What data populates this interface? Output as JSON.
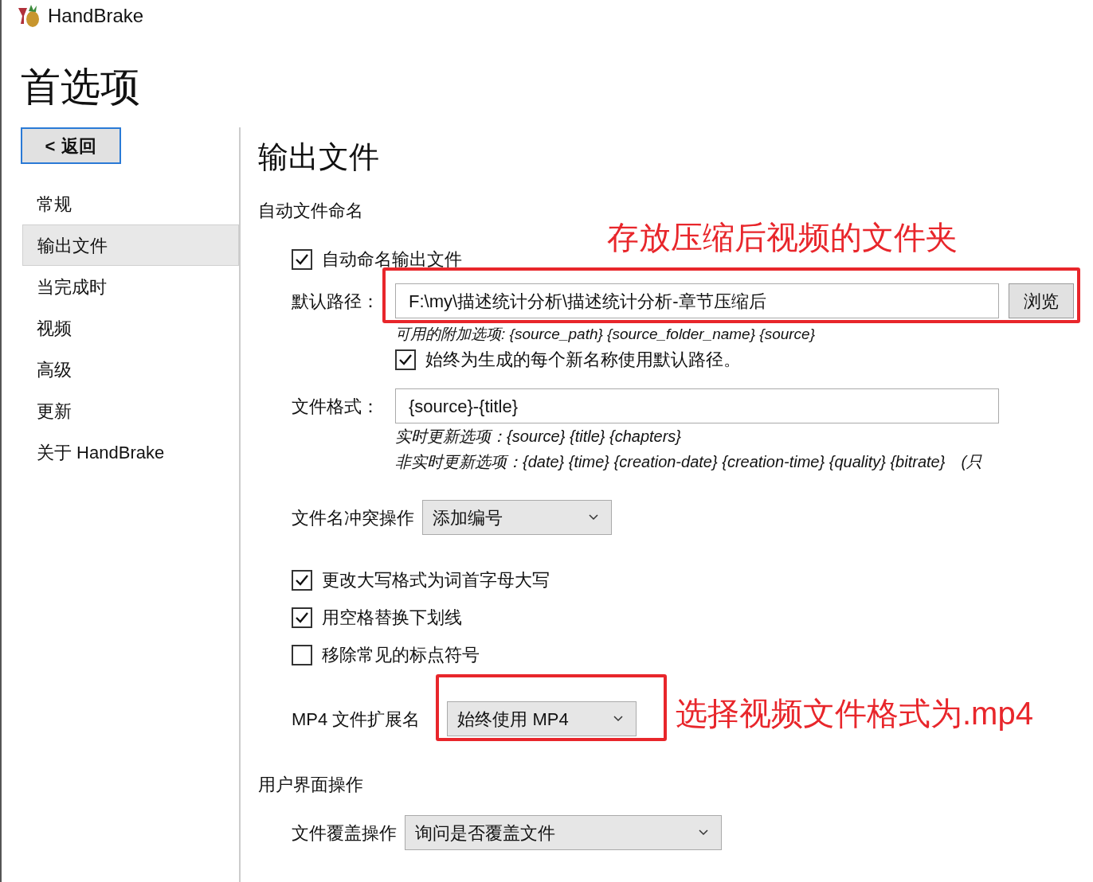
{
  "window": {
    "title": "HandBrake"
  },
  "page_title": "首选项",
  "back_button": {
    "arrow": "<",
    "label": "返回"
  },
  "sidebar": {
    "items": [
      {
        "label": "常规",
        "selected": false
      },
      {
        "label": "输出文件",
        "selected": true
      },
      {
        "label": "当完成时",
        "selected": false
      },
      {
        "label": "视频",
        "selected": false
      },
      {
        "label": "高级",
        "selected": false
      },
      {
        "label": "更新",
        "selected": false
      },
      {
        "label": "关于 HandBrake",
        "selected": false
      }
    ]
  },
  "content": {
    "heading": "输出文件",
    "auto_naming": {
      "title": "自动文件命名",
      "auto_name_checkbox": {
        "label": "自动命名输出文件",
        "checked": true
      },
      "default_path": {
        "label": "默认路径：",
        "value": "F:\\my\\描述统计分析\\描述统计分析-章节压缩后",
        "browse": "浏览"
      },
      "path_hint": "可用的附加选项: {source_path} {source_folder_name} {source}",
      "always_default_checkbox": {
        "label": "始终为生成的每个新名称使用默认路径。",
        "checked": true
      },
      "file_format": {
        "label": "文件格式：",
        "value": "{source}-{title}"
      },
      "format_hints": [
        "实时更新选项：{source} {title} {chapters}",
        "非实时更新选项：{date} {time} {creation-date} {creation-time} {quality} {bitrate}　(只"
      ],
      "conflict": {
        "label": "文件名冲突操作",
        "value": "添加编号"
      },
      "options": [
        {
          "label": "更改大写格式为词首字母大写",
          "checked": true
        },
        {
          "label": "用空格替换下划线",
          "checked": true
        },
        {
          "label": "移除常见的标点符号",
          "checked": false
        }
      ],
      "mp4_extension": {
        "label": "MP4 文件扩展名",
        "value": "始终使用 MP4"
      }
    },
    "ui_actions": {
      "title": "用户界面操作",
      "overwrite": {
        "label": "文件覆盖操作",
        "value": "询问是否覆盖文件"
      }
    }
  },
  "annotations": [
    {
      "text": "存放压缩后视频的文件夹"
    },
    {
      "text": "选择视频文件格式为.mp4"
    }
  ]
}
